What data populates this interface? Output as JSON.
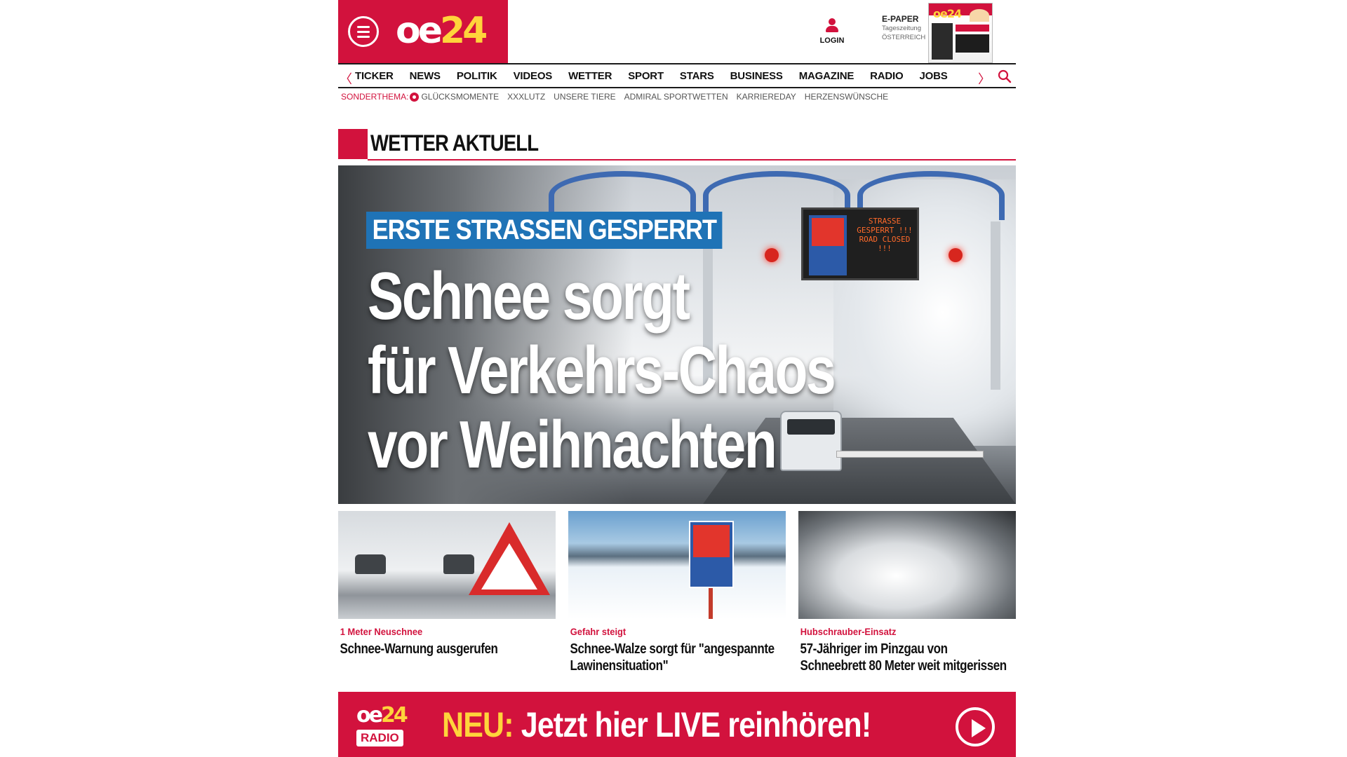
{
  "header": {
    "logo_oe": "oe",
    "logo_num": "24",
    "login_label": "LOGIN",
    "epaper": {
      "title": "E-PAPER",
      "subtitle": "Tageszeitung",
      "region": "ÖSTERREICH"
    }
  },
  "nav": {
    "items": [
      "TICKER",
      "NEWS",
      "POLITIK",
      "VIDEOS",
      "WETTER",
      "SPORT",
      "STARS",
      "BUSINESS",
      "MAGAZINE",
      "RADIO",
      "JOBS"
    ],
    "left_arrow": "〈",
    "right_arrow": "〉"
  },
  "subnav": {
    "label": "SONDERTHEMA:",
    "items": [
      "GLÜCKSMOMENTE",
      "XXXLUTZ",
      "UNSERE TIERE",
      "ADMIRAL SPORTWETTEN",
      "KARRIEREDAY",
      "HERZENSWÜNSCHE"
    ]
  },
  "section": {
    "title": "WETTER AKTUELL"
  },
  "hero": {
    "kicker": "ERSTE STRASSEN GESPERRT",
    "headline_lines": [
      "Schnee sorgt",
      "für Verkehrs-Chaos",
      "vor Weihnachten"
    ],
    "sign_text": "STRASSE GESPERRT !!! ROAD CLOSED !!!"
  },
  "teasers": [
    {
      "kicker": "1 Meter Neuschnee",
      "title": "Schnee-Warnung ausgerufen"
    },
    {
      "kicker": "Gefahr steigt",
      "title": "Schnee-Walze sorgt für \"angespannte Lawinensituation\""
    },
    {
      "kicker": "Hubschrauber-Einsatz",
      "title": "57-Jähriger im Pinzgau von Schneebrett 80 Meter weit mitgerissen"
    }
  ],
  "radio": {
    "logo_oe": "oe",
    "logo_num": "24",
    "logo_radio": "RADIO",
    "neu": "NEU:",
    "claim": "Jetzt hier LIVE reinhören!"
  },
  "colors": {
    "brand_red": "#d2123d",
    "brand_yellow": "#ffd43b",
    "kicker_blue": "#1f73b6"
  }
}
